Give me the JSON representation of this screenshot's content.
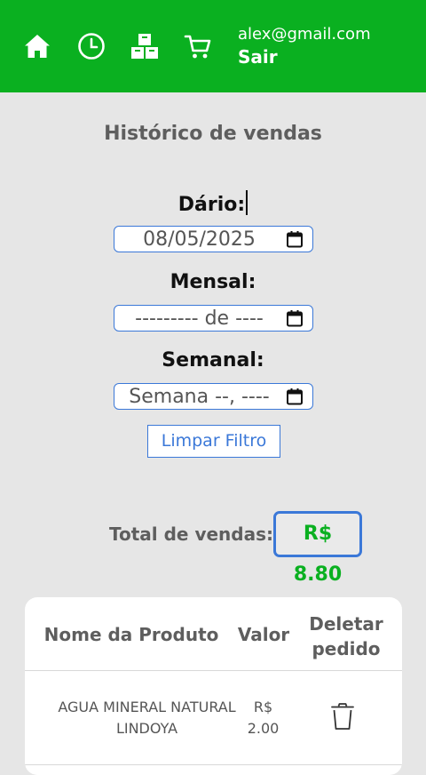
{
  "header": {
    "nav": [
      {
        "icon": "home-icon"
      },
      {
        "icon": "clock-icon"
      },
      {
        "icon": "boxes-icon"
      },
      {
        "icon": "cart-icon"
      }
    ],
    "user_email": "alex@gmail.com",
    "logout_label": "Sair",
    "background_color": "#0ab020"
  },
  "main": {
    "title": "Histórico de vendas",
    "filters": {
      "daily_label": "Dário:",
      "daily_value": "08/05/2025",
      "monthly_label": "Mensal:",
      "monthly_value": "--------- de ----",
      "weekly_label": "Semanal:",
      "weekly_value": "Semana --, ----",
      "clear_label": "Limpar Filtro"
    },
    "total": {
      "label": "Total de vendas:",
      "value": "R$ 8.80",
      "value_color": "#0ab020"
    }
  },
  "table": {
    "headers": {
      "name": "Nome da Produto",
      "value": "Valor",
      "delete": "Deletar pedido"
    },
    "rows": [
      {
        "name": "AGUA MINERAL NATURAL LINDOYA",
        "value": "R$ 2.00",
        "delete_icon": "trash-icon"
      }
    ]
  },
  "colors": {
    "accent_blue": "#3b78d8",
    "background": "#e6e6e6"
  }
}
